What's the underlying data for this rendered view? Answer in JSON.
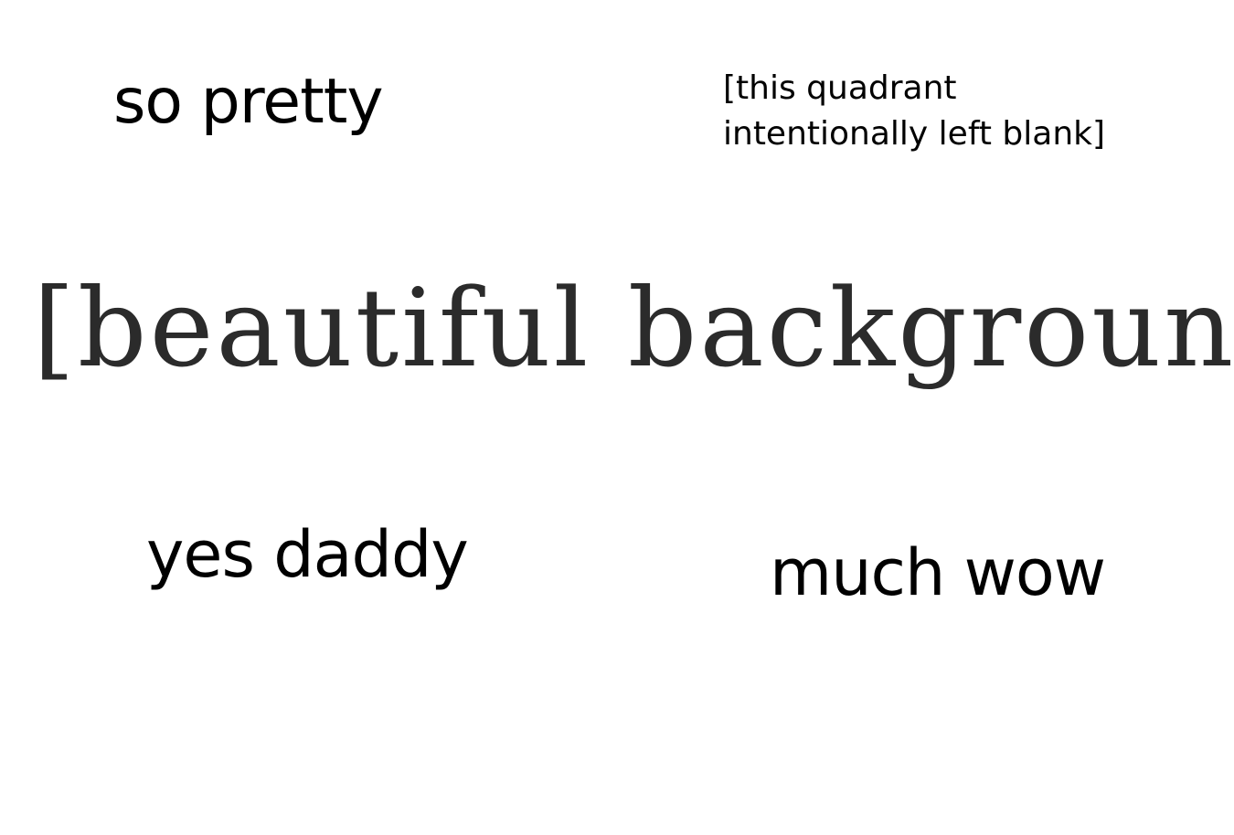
{
  "quadrants": {
    "top_left": "so pretty",
    "top_right_line1": "[this quadrant",
    "top_right_line2": "intentionally left blank]",
    "bottom_left": "yes daddy",
    "bottom_right": "much wow"
  },
  "center_caption": "[beautiful background]",
  "colors": {
    "background": "#ffffff",
    "text": "#000000",
    "center_text": "#2b2b2b"
  }
}
